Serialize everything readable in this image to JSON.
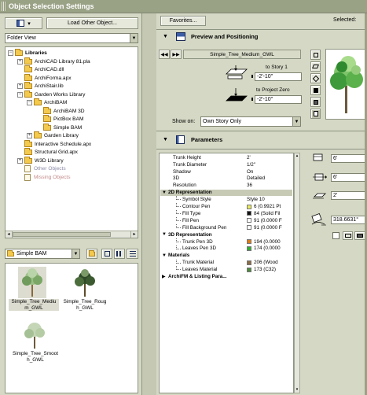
{
  "window": {
    "title": "Object Selection Settings",
    "selected_label": "Selected:"
  },
  "left": {
    "load_button": "Load Other Object...",
    "view_mode": "Folder View",
    "tree": [
      {
        "label": "Libraries",
        "indent": 0,
        "kind": "folder",
        "bold": true,
        "expander": "−"
      },
      {
        "label": "ArchiCAD Library 81.pla",
        "indent": 1,
        "kind": "folder",
        "expander": "+"
      },
      {
        "label": "ArchiCAD.dll",
        "indent": 1,
        "kind": "folder",
        "expander": ""
      },
      {
        "label": "ArchiForma.apx",
        "indent": 1,
        "kind": "folder",
        "expander": ""
      },
      {
        "label": "ArchiStair.lib",
        "indent": 1,
        "kind": "folder",
        "expander": "+"
      },
      {
        "label": "Garden Works Library",
        "indent": 1,
        "kind": "folder",
        "expander": "−"
      },
      {
        "label": "ArchiBAM",
        "indent": 2,
        "kind": "folder",
        "expander": "−"
      },
      {
        "label": "ArchiBAM 3D",
        "indent": 3,
        "kind": "folder",
        "expander": ""
      },
      {
        "label": "PictBox BAM",
        "indent": 3,
        "kind": "folder",
        "expander": ""
      },
      {
        "label": "Simple BAM",
        "indent": 3,
        "kind": "folder",
        "expander": ""
      },
      {
        "label": "Garden Library",
        "indent": 2,
        "kind": "folder",
        "expander": "+"
      },
      {
        "label": "Interactive Schedule.apx",
        "indent": 1,
        "kind": "folder",
        "expander": ""
      },
      {
        "label": "Structural Grid.apx",
        "indent": 1,
        "kind": "folder",
        "expander": ""
      },
      {
        "label": "W3D Library",
        "indent": 1,
        "kind": "folder",
        "expander": "+"
      },
      {
        "label": "Other Objects",
        "indent": 1,
        "kind": "file",
        "expander": "",
        "color": "#8a8aa8"
      },
      {
        "label": "Missing Objects",
        "indent": 1,
        "kind": "file",
        "expander": "",
        "color": "#c48a8a"
      }
    ],
    "current_folder": "Simple BAM",
    "objects": [
      {
        "name": "Simple_Tree_Medium_GWL",
        "line1": "Simple_Tree_Mediu",
        "line2": "m_GWL",
        "selected": true
      },
      {
        "name": "Simple_Tree_Rough_GWL",
        "line1": "Simple_Tree_Roug",
        "line2": "h_GWL",
        "selected": false
      },
      {
        "name": "Simple_Tree_Smooth_GWL",
        "line1": "Simple_Tree_Smoot",
        "line2": "h_GWL",
        "selected": false
      }
    ]
  },
  "favorites_button": "Favorites...",
  "preview": {
    "header": "Preview and Positioning",
    "object_name": "Simple_Tree_Medium_GWL",
    "to_story_label": "to Story 1",
    "to_story_value": "-2'-10\"",
    "to_zero_label": "to Project Zero",
    "to_zero_value": "-2'-10\"",
    "show_on_label": "Show on:",
    "show_on_value": "Own Story Only"
  },
  "parameters": {
    "header": "Parameters",
    "rows": [
      {
        "name": "Trunk Height",
        "value": "2'",
        "level": 0
      },
      {
        "name": "Trunk Diameter",
        "value": "1/2\"",
        "level": 0
      },
      {
        "name": "Shadow",
        "value": "On",
        "level": 0
      },
      {
        "name": "3D",
        "value": "Detailed",
        "level": 0
      },
      {
        "name": "Resolution",
        "value": "36",
        "level": 0
      },
      {
        "name": "2D Representation",
        "value": "",
        "level": "head",
        "highlight": true
      },
      {
        "name": "Symbol Style",
        "value": "Style 10",
        "level": 1
      },
      {
        "name": "Contour Pen",
        "value": "6 (0.9921 Pt",
        "level": 1,
        "swatch": "#e9e95a"
      },
      {
        "name": "Fill Type",
        "value": "84 (Solid Fil",
        "level": 1,
        "swatch": "#111111"
      },
      {
        "name": "Fill Pen",
        "value": "91 (0.0000 F",
        "level": 1,
        "swatch": "#ffffff"
      },
      {
        "name": "Fill Background Pen",
        "value": "91 (0.0000 F",
        "level": 1,
        "swatch": "#ffffff"
      },
      {
        "name": "3D Representation",
        "value": "",
        "level": "head"
      },
      {
        "name": "Trunk Pen 3D",
        "value": "194 (0.0000",
        "level": 1,
        "swatch": "#e07a10"
      },
      {
        "name": "Leaves Pen 3D",
        "value": "174 (0.0000",
        "level": 1,
        "swatch": "#2fae2f"
      },
      {
        "name": "Materials",
        "value": "",
        "level": "head"
      },
      {
        "name": "Trunk Material",
        "value": "206 (Wood",
        "level": 1,
        "swatch": "#8b6b44"
      },
      {
        "name": "Leaves Material",
        "value": "173 (C32)",
        "level": 1,
        "swatch": "#4c8a3c"
      },
      {
        "name": "ArchiFM & Listing Para...",
        "value": "",
        "level": "head-collapsed"
      }
    ],
    "right_fields": {
      "height": "6'",
      "width": "6'",
      "depth": "2'",
      "angle": "318.6631°"
    }
  }
}
